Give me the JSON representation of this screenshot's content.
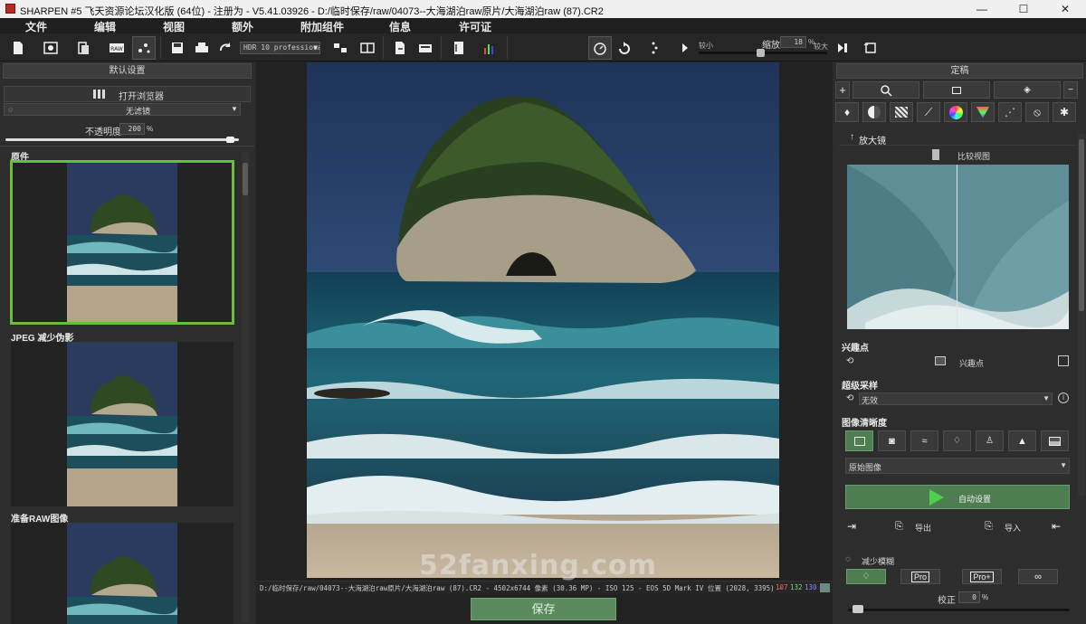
{
  "titlebar": {
    "title": "SHARPEN #5 飞天资源论坛汉化版 (64位) - 注册为 - V5.41.03926 - D:/临时保存/raw/04073--大海湖泊raw原片/大海湖泊raw (87).CR2",
    "minimize": "—",
    "maximize": "☐",
    "close": "✕"
  },
  "menu": [
    "文件",
    "编辑",
    "视图",
    "额外",
    "附加组件",
    "信息",
    "许可证"
  ],
  "toolbar": {
    "output_profile": "HDR 10 professional",
    "zoom_small_label": "较小",
    "zoom_label": "缩放",
    "zoom_value": "18",
    "zoom_unit": "%",
    "zoom_large_label": "较大",
    "zoom_fraction": 0.48
  },
  "left": {
    "header": "默认设置",
    "open_browser": "打开浏览器",
    "filter_value": "无滤镜",
    "opacity_label": "不透明度",
    "opacity_value": "200",
    "opacity_unit": "%",
    "opacity_fraction": 0.98,
    "presets": [
      {
        "label": "原件"
      },
      {
        "label": "JPEG 减少伪影"
      },
      {
        "label": "准备RAW图像"
      }
    ]
  },
  "status": {
    "path": "D:/临时保存/raw/04073--大海湖泊raw原片/大海湖泊raw (87).CR2 - 4502x6744 像素 (30.36 MP) - ISO 125 - EOS 5D Mark IV",
    "position": "位置 (2028, 3395) -",
    "r": "107",
    "g": "132",
    "b": "130"
  },
  "save_button": "保存",
  "watermark": "52fanxing.com",
  "right": {
    "header": "定稿",
    "magnifier_title": "放大镜",
    "compare_label": "比较视图",
    "interest_title": "兴趣点",
    "interest_label": "兴趣点",
    "supersample_title": "超级采样",
    "supersample_value": "无效",
    "clarity_title": "图像清晰度",
    "clarity_mode": "原始图像",
    "auto_settings": "自动设置",
    "export_label": "导出",
    "import_label": "导入",
    "reduce_blur": "减少模糊",
    "blur_modes": [
      "Pro",
      "Pro+"
    ],
    "correction_label": "校正",
    "correction_value": "0",
    "correction_unit": "%",
    "correction_fraction": 0.02
  },
  "colors": {
    "accent_green": "#6bbd3c",
    "save_green": "#5a8a5e",
    "auto_green": "#4f7d52"
  }
}
